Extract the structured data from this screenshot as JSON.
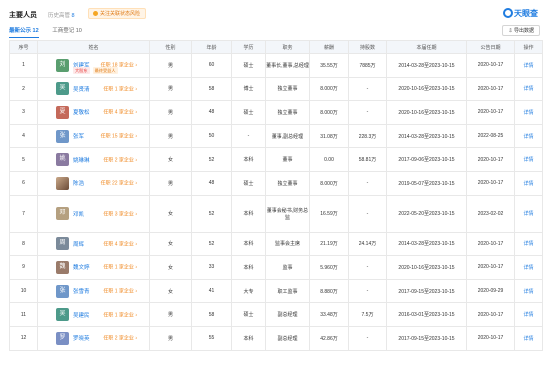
{
  "header": {
    "title": "主要人员",
    "history_label": "历史高管",
    "history_count": "8",
    "tag_label": "关注关联状态风险",
    "logo_text": "天眼查",
    "export_label": "导出数据"
  },
  "tabs": [
    {
      "label": "最新公示 12"
    },
    {
      "label": "工商登记 10"
    }
  ],
  "columns": [
    "序号",
    "姓名",
    "性别",
    "年龄",
    "学历",
    "职务",
    "薪酬",
    "持股数",
    "本届任期",
    "公告日期",
    "操作"
  ],
  "rows": [
    {
      "no": "1",
      "initial": "刘",
      "color": "#5a9e6f",
      "name": "刘建军",
      "role": "任职 18 家企业",
      "badges": [
        "大股东",
        "最终受益人"
      ],
      "gender": "男",
      "age": "60",
      "edu": "硕士",
      "title": "董事长,董事,总经理",
      "pay": "35.55万",
      "shares": "7885万",
      "term": "2014-03-28至2023-10-15",
      "date": "2020-10-17",
      "action": "详情"
    },
    {
      "no": "2",
      "initial": "吴",
      "color": "#4d9a8a",
      "name": "吴贤清",
      "role": "任职 1 家企业",
      "badges": [],
      "gender": "男",
      "age": "58",
      "edu": "博士",
      "title": "独立董事",
      "pay": "8.000万",
      "shares": "-",
      "term": "2020-10-16至2023-10-15",
      "date": "2020-10-17",
      "action": "详情"
    },
    {
      "no": "3",
      "initial": "夏",
      "color": "#c4695a",
      "name": "夏敬松",
      "role": "任职 4 家企业",
      "badges": [],
      "gender": "男",
      "age": "48",
      "edu": "硕士",
      "title": "独立董事",
      "pay": "8.000万",
      "shares": "-",
      "term": "2020-10-16至2023-10-15",
      "date": "2020-10-17",
      "action": "详情"
    },
    {
      "no": "4",
      "initial": "张",
      "color": "#6f97c9",
      "name": "张军",
      "role": "任职 15 家企业",
      "badges": [],
      "gender": "男",
      "age": "50",
      "edu": "-",
      "title": "董事,副总经理",
      "pay": "31.08万",
      "shares": "228.3万",
      "term": "2014-03-28至2023-10-15",
      "date": "2022-08-25",
      "action": "详情"
    },
    {
      "no": "5",
      "initial": "姚",
      "color": "#8a7aa0",
      "name": "姚琳琳",
      "role": "任职 2 家企业",
      "badges": [],
      "gender": "女",
      "age": "52",
      "edu": "本科",
      "title": "董事",
      "pay": "0.00",
      "shares": "58.81万",
      "term": "2017-09-06至2023-10-15",
      "date": "2020-10-17",
      "action": "详情"
    },
    {
      "no": "6",
      "initial": "陈",
      "color": "photo",
      "name": "陈浩",
      "role": "任职 22 家企业",
      "badges": [],
      "gender": "男",
      "age": "48",
      "edu": "硕士",
      "title": "独立董事",
      "pay": "8.000万",
      "shares": "-",
      "term": "2019-05-07至2023-10-15",
      "date": "2020-10-17",
      "action": "详情"
    },
    {
      "no": "7",
      "initial": "邓",
      "color": "#b5a080",
      "name": "邓凯",
      "role": "任职 3 家企业",
      "badges": [],
      "gender": "女",
      "age": "52",
      "edu": "本科",
      "title": "董事会秘书,财务总监",
      "pay": "16.59万",
      "shares": "-",
      "term": "2022-05-20至2023-10-15",
      "date": "2023-02-02",
      "action": "详情"
    },
    {
      "no": "8",
      "initial": "周",
      "color": "#7b8a9a",
      "name": "周辉",
      "role": "任职 4 家企业",
      "badges": [],
      "gender": "女",
      "age": "52",
      "edu": "本科",
      "title": "监事会主席",
      "pay": "21.19万",
      "shares": "24.14万",
      "term": "2014-03-28至2023-10-15",
      "date": "2020-10-17",
      "action": "详情"
    },
    {
      "no": "9",
      "initial": "魏",
      "color": "#9a7b6a",
      "name": "魏文婷",
      "role": "任职 1 家企业",
      "badges": [],
      "gender": "女",
      "age": "33",
      "edu": "本科",
      "title": "监事",
      "pay": "5.960万",
      "shares": "-",
      "term": "2020-10-16至2023-10-15",
      "date": "2020-10-17",
      "action": "详情"
    },
    {
      "no": "10",
      "initial": "张",
      "color": "#6f97c9",
      "name": "张雪青",
      "role": "任职 1 家企业",
      "badges": [],
      "gender": "女",
      "age": "41",
      "edu": "大专",
      "title": "职工监事",
      "pay": "8.880万",
      "shares": "-",
      "term": "2017-09-15至2023-10-15",
      "date": "2020-09-29",
      "action": "详情"
    },
    {
      "no": "11",
      "initial": "吴",
      "color": "#4d9a8a",
      "name": "吴建民",
      "role": "任职 1 家企业",
      "badges": [],
      "gender": "男",
      "age": "58",
      "edu": "硕士",
      "title": "副总经理",
      "pay": "33.48万",
      "shares": "7.5万",
      "term": "2016-03-01至2023-10-15",
      "date": "2020-10-17",
      "action": "详情"
    },
    {
      "no": "12",
      "initial": "罗",
      "color": "#7a8fc4",
      "name": "罗晓英",
      "role": "任职 2 家企业",
      "badges": [],
      "gender": "男",
      "age": "55",
      "edu": "本科",
      "title": "副总经理",
      "pay": "42.86万",
      "shares": "-",
      "term": "2017-09-15至2023-10-15",
      "date": "2020-10-17",
      "action": "详情"
    }
  ]
}
